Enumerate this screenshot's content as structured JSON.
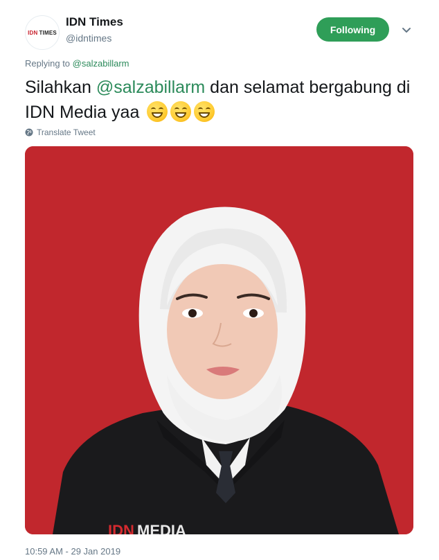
{
  "header": {
    "avatar_logo_red": "IDN",
    "avatar_logo_dark": "TIMES",
    "display_name": "IDN Times",
    "handle": "@idntimes",
    "follow_label": "Following",
    "menu_icon": "chevron-down-icon"
  },
  "reply": {
    "prefix": "Replying to",
    "mention": "@salzabillarm"
  },
  "tweet": {
    "text_before": "Silahkan ",
    "mention": "@salzabillarm",
    "text_after": " dan selamat bergabung di IDN Media yaa",
    "emoji_count": 3,
    "emoji": "grinning-squinting-face"
  },
  "translate": {
    "icon": "globe-icon",
    "label": "Translate Tweet"
  },
  "photo": {
    "background_color": "#c1272d",
    "shirt_text_red": "IDN",
    "shirt_text_white": " MEDIA"
  },
  "timestamp": "10:59 AM - 29 Jan 2019",
  "colors": {
    "accent_green": "#2f9e58",
    "mention_green": "#2b8a5a",
    "muted": "#657786"
  }
}
